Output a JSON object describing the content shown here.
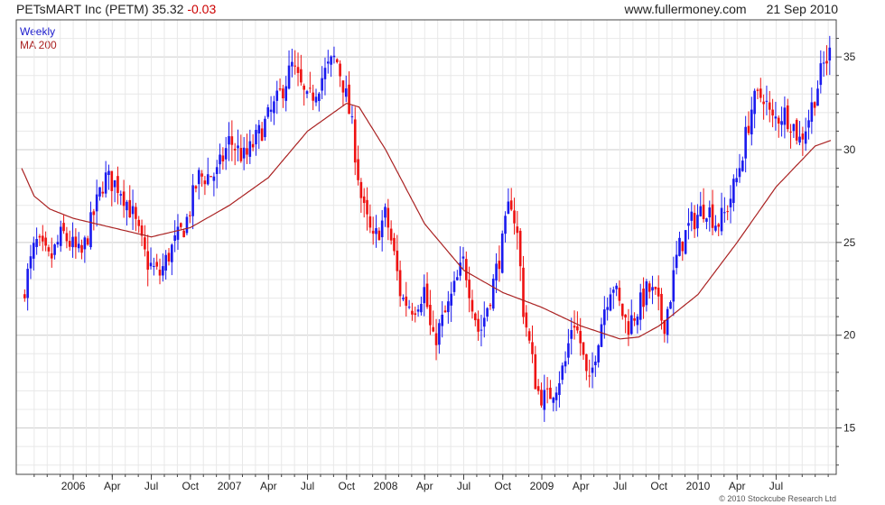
{
  "header": {
    "symbol": "PETsMART Inc (PETM)",
    "price": "35.32",
    "change": "-0.03",
    "site": "www.fullermoney.com",
    "date": "21 Sep 2010"
  },
  "legend": {
    "weekly": "Weekly",
    "ma": "MA 200"
  },
  "copyright": "© 2010 Stockcube Research Ltd",
  "colors": {
    "up": "#1a1aee",
    "down": "#ee1111",
    "ma": "#aa2222",
    "grid": "#dddddd",
    "frame": "#444444"
  },
  "chart_data": {
    "type": "candlestick",
    "title": "PETsMART Inc (PETM)",
    "period": "Weekly",
    "xlabel": "",
    "ylabel": "",
    "ylim": [
      12.5,
      37
    ],
    "grid": true,
    "y_ticks": [
      15,
      20,
      25,
      30,
      35
    ],
    "x_ticks": [
      "2006",
      "Apr",
      "Jul",
      "Oct",
      "2007",
      "Apr",
      "Jul",
      "Oct",
      "2008",
      "Apr",
      "Jul",
      "Oct",
      "2009",
      "Apr",
      "Jul",
      "Oct",
      "2010",
      "Apr",
      "Jul"
    ],
    "x_tick_times": [
      2006.0,
      2006.25,
      2006.5,
      2006.75,
      2007.0,
      2007.25,
      2007.5,
      2007.75,
      2008.0,
      2008.25,
      2008.5,
      2008.75,
      2009.0,
      2009.25,
      2009.5,
      2009.75,
      2010.0,
      2010.25,
      2010.5
    ],
    "xlim": [
      2005.67,
      2010.85
    ],
    "close_anchors": [
      [
        2005.67,
        22.0
      ],
      [
        2005.76,
        25.0
      ],
      [
        2005.85,
        24.0
      ],
      [
        2005.93,
        25.5
      ],
      [
        2006.05,
        24.2
      ],
      [
        2006.2,
        28.5
      ],
      [
        2006.3,
        28.0
      ],
      [
        2006.38,
        26.5
      ],
      [
        2006.47,
        24.0
      ],
      [
        2006.55,
        23.2
      ],
      [
        2006.62,
        24.5
      ],
      [
        2006.72,
        26.0
      ],
      [
        2006.8,
        28.5
      ],
      [
        2006.92,
        28.7
      ],
      [
        2007.0,
        30.5
      ],
      [
        2007.1,
        29.5
      ],
      [
        2007.2,
        31.0
      ],
      [
        2007.3,
        32.5
      ],
      [
        2007.4,
        34.5
      ],
      [
        2007.5,
        32.5
      ],
      [
        2007.6,
        34.0
      ],
      [
        2007.68,
        35.0
      ],
      [
        2007.73,
        33.5
      ],
      [
        2007.78,
        31.5
      ],
      [
        2007.85,
        27.0
      ],
      [
        2007.92,
        25.0
      ],
      [
        2008.0,
        26.5
      ],
      [
        2008.05,
        24.5
      ],
      [
        2008.1,
        22.0
      ],
      [
        2008.18,
        21.5
      ],
      [
        2008.25,
        22.5
      ],
      [
        2008.3,
        19.5
      ],
      [
        2008.4,
        21.5
      ],
      [
        2008.5,
        24.0
      ],
      [
        2008.55,
        22.0
      ],
      [
        2008.6,
        20.0
      ],
      [
        2008.68,
        22.5
      ],
      [
        2008.75,
        25.0
      ],
      [
        2008.8,
        27.5
      ],
      [
        2008.85,
        25.0
      ],
      [
        2008.88,
        21.5
      ],
      [
        2008.93,
        19.0
      ],
      [
        2008.97,
        17.0
      ],
      [
        2009.03,
        16.5
      ],
      [
        2009.1,
        17.5
      ],
      [
        2009.15,
        18.5
      ],
      [
        2009.2,
        21.0
      ],
      [
        2009.25,
        19.5
      ],
      [
        2009.3,
        17.0
      ],
      [
        2009.35,
        19.5
      ],
      [
        2009.4,
        21.5
      ],
      [
        2009.45,
        23.0
      ],
      [
        2009.5,
        21.5
      ],
      [
        2009.55,
        20.5
      ],
      [
        2009.62,
        21.5
      ],
      [
        2009.68,
        22.5
      ],
      [
        2009.73,
        22.0
      ],
      [
        2009.78,
        20.5
      ],
      [
        2009.82,
        22.0
      ],
      [
        2009.87,
        24.5
      ],
      [
        2009.95,
        26.0
      ],
      [
        2010.05,
        27.0
      ],
      [
        2010.12,
        26.0
      ],
      [
        2010.17,
        26.5
      ],
      [
        2010.25,
        28.5
      ],
      [
        2010.3,
        30.5
      ],
      [
        2010.35,
        32.5
      ],
      [
        2010.42,
        33.0
      ],
      [
        2010.47,
        31.5
      ],
      [
        2010.55,
        32.0
      ],
      [
        2010.6,
        31.5
      ],
      [
        2010.65,
        30.5
      ],
      [
        2010.7,
        31.5
      ],
      [
        2010.75,
        33.0
      ],
      [
        2010.8,
        34.5
      ],
      [
        2010.85,
        35.3
      ]
    ],
    "ma_anchors": [
      [
        2005.67,
        29.0
      ],
      [
        2005.75,
        27.5
      ],
      [
        2005.85,
        26.8
      ],
      [
        2006.0,
        26.3
      ],
      [
        2006.25,
        25.8
      ],
      [
        2006.5,
        25.3
      ],
      [
        2006.75,
        25.8
      ],
      [
        2007.0,
        27.0
      ],
      [
        2007.25,
        28.5
      ],
      [
        2007.5,
        31.0
      ],
      [
        2007.75,
        32.5
      ],
      [
        2007.83,
        32.3
      ],
      [
        2008.0,
        30.0
      ],
      [
        2008.25,
        26.0
      ],
      [
        2008.5,
        23.5
      ],
      [
        2008.75,
        22.3
      ],
      [
        2009.0,
        21.5
      ],
      [
        2009.25,
        20.5
      ],
      [
        2009.5,
        19.8
      ],
      [
        2009.62,
        19.9
      ],
      [
        2009.75,
        20.5
      ],
      [
        2010.0,
        22.2
      ],
      [
        2010.25,
        25.0
      ],
      [
        2010.5,
        28.0
      ],
      [
        2010.75,
        30.2
      ],
      [
        2010.85,
        30.5
      ]
    ]
  }
}
